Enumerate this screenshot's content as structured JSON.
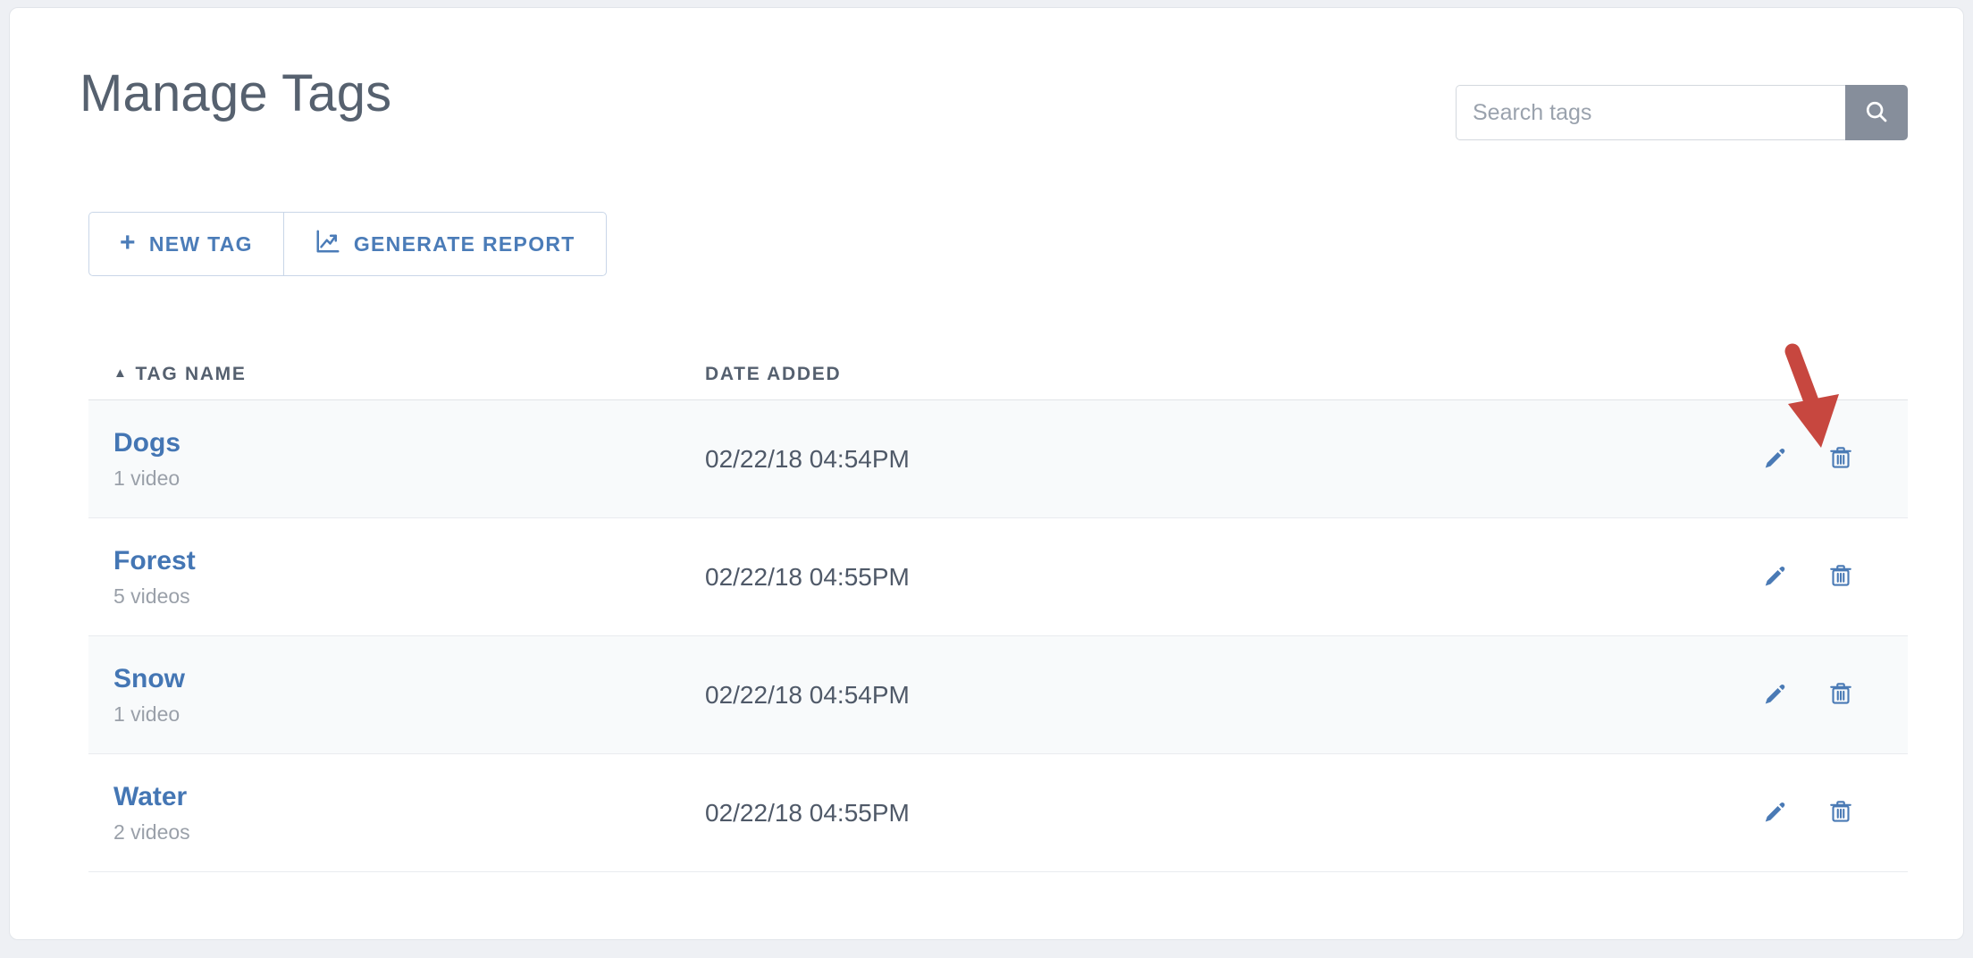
{
  "header": {
    "title": "Manage Tags"
  },
  "search": {
    "placeholder": "Search tags",
    "value": "",
    "button_icon": "search-icon"
  },
  "toolbar": {
    "new_tag_label": "NEW TAG",
    "new_tag_icon": "plus-icon",
    "generate_report_label": "GENERATE REPORT",
    "generate_report_icon": "chart-line-icon"
  },
  "table": {
    "columns": {
      "tag_name": "TAG NAME",
      "date_added": "DATE ADDED",
      "sort_indicator": "▲"
    },
    "rows": [
      {
        "name": "Dogs",
        "count": "1 video",
        "date": "02/22/18 04:54PM",
        "edit_icon": "pencil-icon",
        "delete_icon": "trash-icon"
      },
      {
        "name": "Forest",
        "count": "5 videos",
        "date": "02/22/18 04:55PM",
        "edit_icon": "pencil-icon",
        "delete_icon": "trash-icon"
      },
      {
        "name": "Snow",
        "count": "1 video",
        "date": "02/22/18 04:54PM",
        "edit_icon": "pencil-icon",
        "delete_icon": "trash-icon"
      },
      {
        "name": "Water",
        "count": "2 videos",
        "date": "02/22/18 04:55PM",
        "edit_icon": "pencil-icon",
        "delete_icon": "trash-icon"
      }
    ]
  },
  "annotation": {
    "type": "arrow",
    "color": "#c7473f",
    "points_to": "delete-button-row-1"
  },
  "colors": {
    "link_blue": "#4476b4",
    "title_slate": "#56616f",
    "search_button_gray": "#868e9b",
    "row_stripe": "#f8fafb",
    "annotation_red": "#c7473f"
  }
}
